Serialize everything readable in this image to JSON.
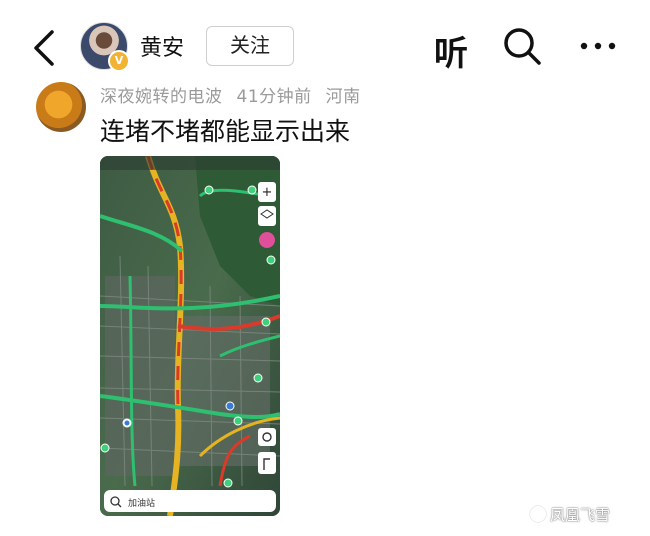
{
  "header": {
    "author_name": "黄安",
    "follow_label": "关注",
    "listen_label": "听"
  },
  "comment": {
    "username": "深夜婉转的电波",
    "time": "41分钟前",
    "location": "河南",
    "text": "连堵不堵都能显示出来"
  },
  "map_screenshot": {
    "search_placeholder": "加油站",
    "zoom_plus": "+",
    "layer_label": "图层"
  },
  "watermark": "凤凰飞雪",
  "colors": {
    "jam_red": "#d93a2a",
    "slow_yellow": "#e6b422",
    "clear_green": "#2fbf71"
  }
}
